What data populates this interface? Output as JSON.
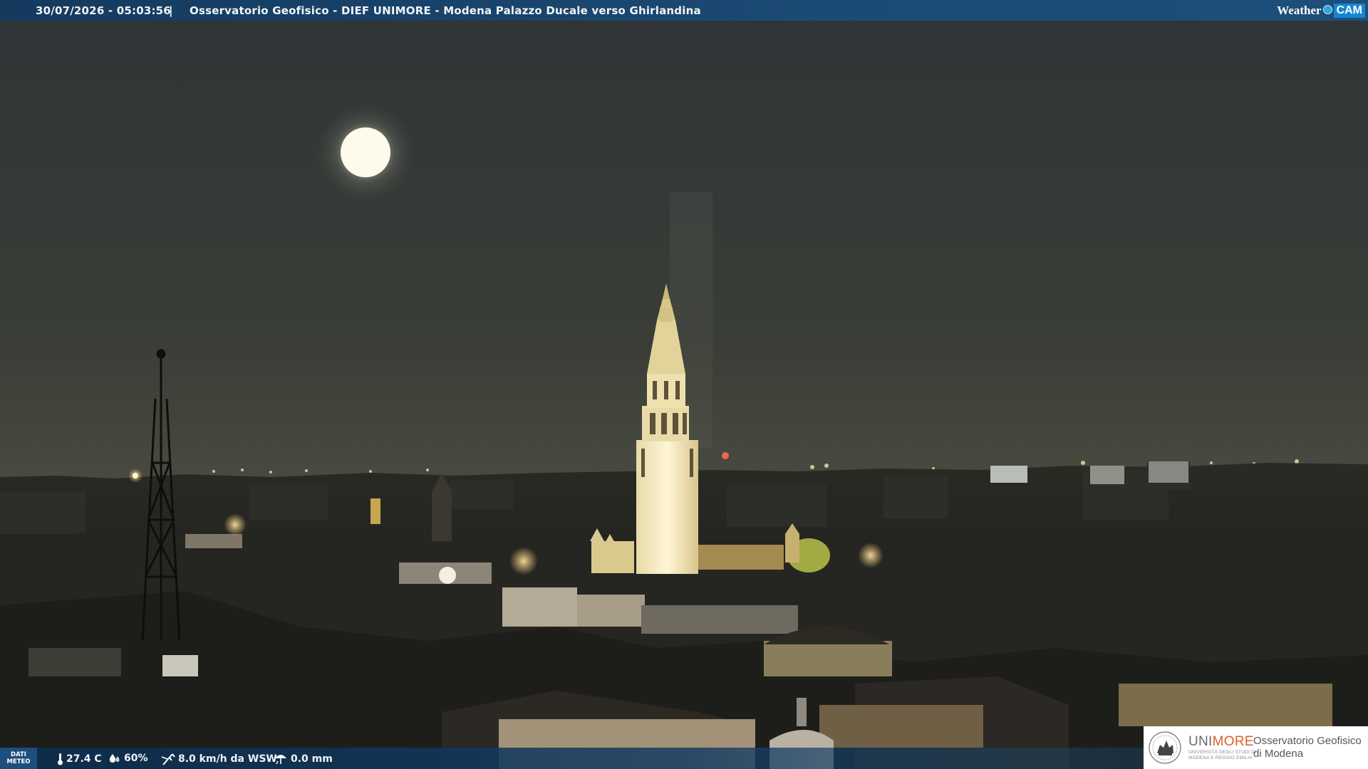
{
  "header": {
    "timestamp": "30/07/2026 - 05:03:56",
    "separator": "|",
    "caption": "Osservatorio Geofisico - DIEF UNIMORE - Modena Palazzo Ducale verso Ghirlandina",
    "brand_left": "Weather",
    "brand_right": "CAM"
  },
  "meteo": {
    "badge_line1": "DATI",
    "badge_line2": "METEO",
    "temperature": "27.4 C",
    "humidity": "60%",
    "wind": "8.0 km/h da WSW",
    "rain": "0.0 mm",
    "icons": [
      "thermometer-icon",
      "humidity-drop-icon",
      "wind-icon",
      "rain-gauge-icon"
    ]
  },
  "logo": {
    "university_main": "UNI",
    "university_accent": "MORE",
    "university_line1": "UNIVERSITÀ DEGLI STUDI DI",
    "university_line2": "MODENA E REGGIO EMILIA",
    "observatory_line1": "Osservatorio Geofisico",
    "observatory_line2": "di Modena"
  },
  "colors": {
    "sky": "#3b3f37",
    "bar": "#1b4a74",
    "accent": "#d8622a",
    "wc_blue": "#1686cf"
  }
}
